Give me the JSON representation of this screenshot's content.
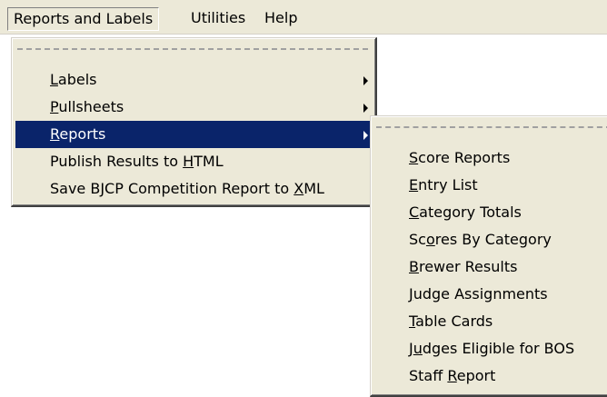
{
  "menubar": {
    "items": [
      {
        "label": "Reports and Labels"
      },
      {
        "label": "Utilities"
      },
      {
        "label": "Help"
      }
    ]
  },
  "menu": {
    "items": [
      {
        "label": "Labels",
        "accel": "L",
        "submenu": true
      },
      {
        "label": "Pullsheets",
        "accel": "P",
        "submenu": true
      },
      {
        "label": "Reports",
        "accel": "R",
        "submenu": true
      },
      {
        "label": "Publish Results to HTML",
        "accel": "H",
        "submenu": false
      },
      {
        "label": "Save BJCP Competition Report to XML",
        "accel": "X",
        "submenu": false
      }
    ]
  },
  "submenu": {
    "items": [
      {
        "label": "Score Reports",
        "accel": "S"
      },
      {
        "label": "Entry List",
        "accel": "E"
      },
      {
        "label": "Category Totals",
        "accel": "C"
      },
      {
        "label": "Scores By Category",
        "accel": "o"
      },
      {
        "label": "Brewer Results",
        "accel": "B"
      },
      {
        "label": "Judge Assignments",
        "accel": "J"
      },
      {
        "label": "Table Cards",
        "accel": "T"
      },
      {
        "label": "Judges Eligible for BOS",
        "accel": "u"
      },
      {
        "label": "Staff Report",
        "accel": "R"
      }
    ]
  },
  "colors": {
    "menu_bg": "#ece9d8",
    "highlight": "#0a246a"
  }
}
